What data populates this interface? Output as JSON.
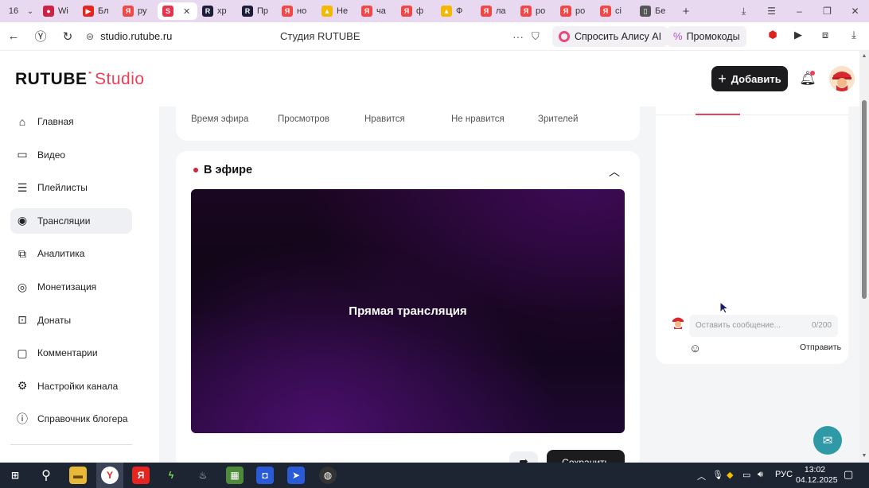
{
  "browser": {
    "tab_count": "16",
    "tabs": [
      {
        "label": "Wi",
        "color": "#cc2244",
        "glyph": "●"
      },
      {
        "label": "Бл",
        "color": "#e52620",
        "glyph": "▶"
      },
      {
        "label": "ру",
        "color": "#f04747",
        "glyph": "Я"
      },
      {
        "label": "",
        "color": "#e9334c",
        "glyph": "S"
      },
      {
        "label": "хр",
        "color": "#1b1d3a",
        "glyph": "R"
      },
      {
        "label": "Пр",
        "color": "#1b1d3a",
        "glyph": "R"
      },
      {
        "label": "но",
        "color": "#f04747",
        "glyph": "Я"
      },
      {
        "label": "Не",
        "color": "#f5b800",
        "glyph": "▲"
      },
      {
        "label": "ча",
        "color": "#f04747",
        "glyph": "Я"
      },
      {
        "label": "ф",
        "color": "#f04747",
        "glyph": "Я"
      },
      {
        "label": "Ф",
        "color": "#f5b800",
        "glyph": "▲"
      },
      {
        "label": "ла",
        "color": "#f04747",
        "glyph": "Я"
      },
      {
        "label": "ро",
        "color": "#f04747",
        "glyph": "Я"
      },
      {
        "label": "ро",
        "color": "#f04747",
        "glyph": "Я"
      },
      {
        "label": "сі",
        "color": "#f04747",
        "glyph": "Я"
      },
      {
        "label": "Бе",
        "color": "#555555",
        "glyph": "▯"
      }
    ],
    "url": "studio.rutube.ru",
    "page_title": "Студия RUTUBE",
    "alice_label": "Спросить Алису AI",
    "promo_label": "Промокоды"
  },
  "header": {
    "logo_main": "RUTUBE",
    "logo_studio": "Studio",
    "add_label": "Добавить"
  },
  "sidebar": {
    "items": [
      {
        "label": "Главная",
        "icon": "home-icon",
        "glyph": "⌂"
      },
      {
        "label": "Видео",
        "icon": "video-icon",
        "glyph": "▭"
      },
      {
        "label": "Плейлисты",
        "icon": "playlist-icon",
        "glyph": "☰"
      },
      {
        "label": "Трансляции",
        "icon": "broadcast-icon",
        "glyph": "◉"
      },
      {
        "label": "Аналитика",
        "icon": "analytics-icon",
        "glyph": "⧉"
      },
      {
        "label": "Монетизация",
        "icon": "monetization-icon",
        "glyph": "◎"
      },
      {
        "label": "Донаты",
        "icon": "donate-icon",
        "glyph": "⊡"
      },
      {
        "label": "Комментарии",
        "icon": "comments-icon",
        "glyph": "▢"
      },
      {
        "label": "Настройки канала",
        "icon": "settings-icon",
        "glyph": "⚙"
      },
      {
        "label": "Справочник блогера",
        "icon": "info-icon",
        "glyph": "ⓘ"
      }
    ]
  },
  "stats": {
    "labels": [
      "Время эфира",
      "Просмотров",
      "Нравится",
      "Не нравится",
      "Зрителей"
    ]
  },
  "live": {
    "title": "В эфире",
    "player_text": "Прямая трансляция",
    "save_label": "Сохранить"
  },
  "chat": {
    "placeholder": "Оставить сообщение...",
    "counter": "0/200",
    "send_label": "Отправить"
  },
  "taskbar": {
    "lang": "РУС",
    "time": "13:02",
    "date": "04.12.2025"
  }
}
